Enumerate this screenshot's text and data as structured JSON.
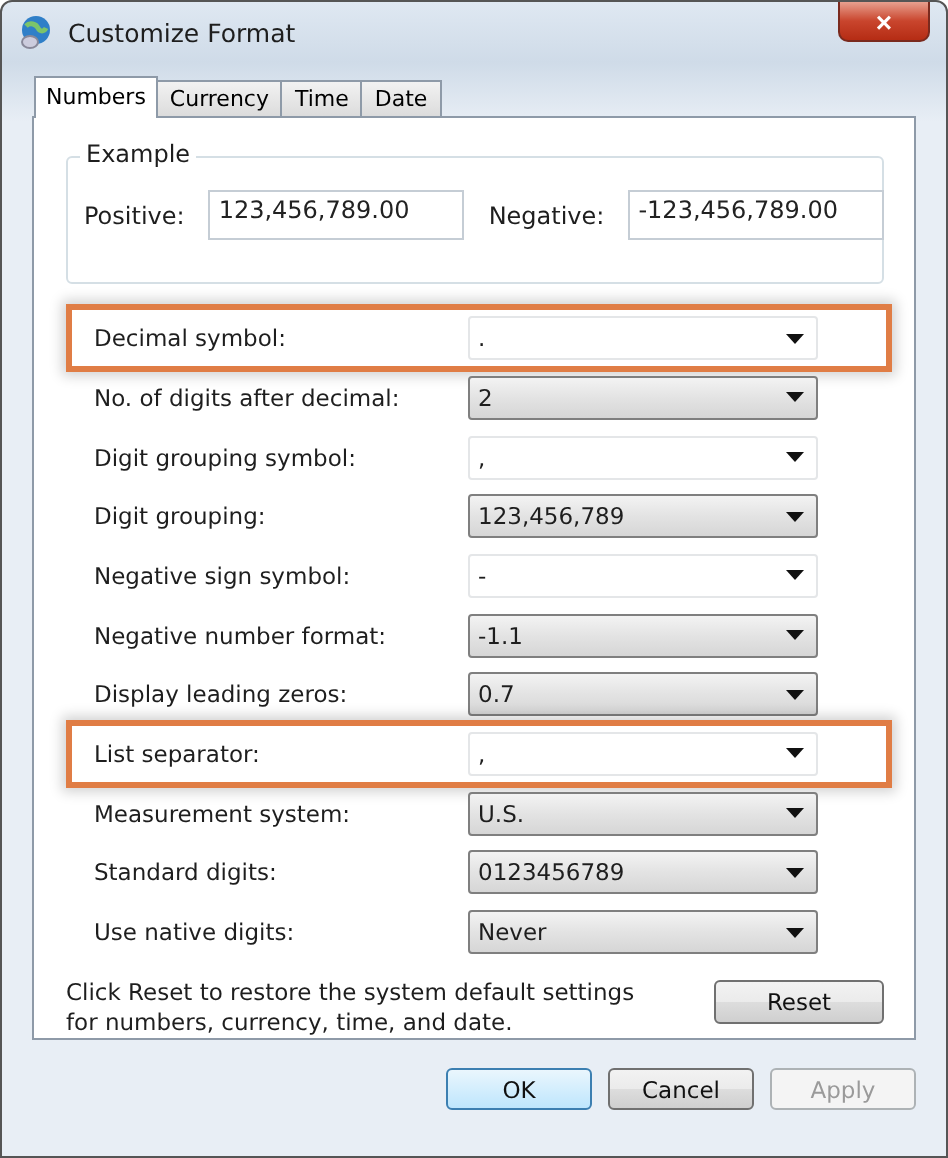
{
  "window": {
    "title": "Customize Format",
    "close": "×"
  },
  "tabs": [
    {
      "label": "Numbers",
      "selected": true
    },
    {
      "label": "Currency",
      "selected": false
    },
    {
      "label": "Time",
      "selected": false
    },
    {
      "label": "Date",
      "selected": false
    }
  ],
  "example": {
    "title": "Example",
    "positive_label": "Positive:",
    "positive_value": "123,456,789.00",
    "negative_label": "Negative:",
    "negative_value": "-123,456,789.00"
  },
  "settings": [
    {
      "label": "Decimal symbol:",
      "value": ".",
      "kind": "editable",
      "highlighted": true
    },
    {
      "label": "No. of digits after decimal:",
      "value": "2",
      "kind": "list",
      "highlighted": false
    },
    {
      "label": "Digit grouping symbol:",
      "value": ",",
      "kind": "editable",
      "highlighted": false
    },
    {
      "label": "Digit grouping:",
      "value": "123,456,789",
      "kind": "list",
      "highlighted": false
    },
    {
      "label": "Negative sign symbol:",
      "value": "-",
      "kind": "editable",
      "highlighted": false
    },
    {
      "label": "Negative number format:",
      "value": "-1.1",
      "kind": "list",
      "highlighted": false
    },
    {
      "label": "Display leading zeros:",
      "value": "0.7",
      "kind": "list",
      "highlighted": false
    },
    {
      "label": "List separator:",
      "value": ",",
      "kind": "editable",
      "highlighted": true
    },
    {
      "label": "Measurement system:",
      "value": "U.S.",
      "kind": "list",
      "highlighted": false
    },
    {
      "label": "Standard digits:",
      "value": "0123456789",
      "kind": "list",
      "highlighted": false
    },
    {
      "label": "Use native digits:",
      "value": "Never",
      "kind": "list",
      "highlighted": false
    }
  ],
  "reset_note": "Click Reset to restore the system default settings for numbers, currency, time, and date.",
  "reset_button": "Reset",
  "buttons": [
    {
      "label": "OK",
      "kind": "default",
      "disabled": false
    },
    {
      "label": "Cancel",
      "kind": "normal",
      "disabled": false
    },
    {
      "label": "Apply",
      "kind": "normal",
      "disabled": true
    }
  ]
}
